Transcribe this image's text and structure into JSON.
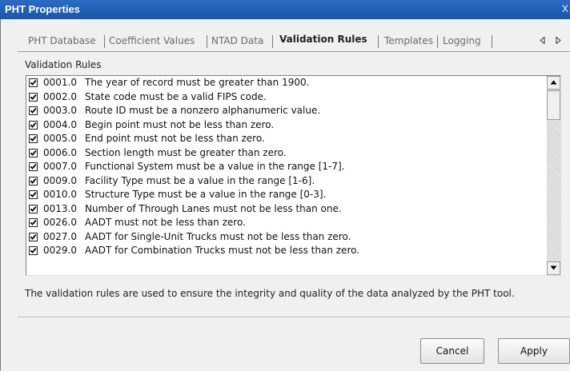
{
  "window": {
    "title": "PHT Properties",
    "close_glyph": "X"
  },
  "tabs": [
    {
      "label": "PHT Database",
      "active": false
    },
    {
      "label": "Coefficient Values",
      "active": false
    },
    {
      "label": "NTAD Data",
      "active": false
    },
    {
      "label": "Validation Rules",
      "active": true
    },
    {
      "label": "Templates",
      "active": false
    },
    {
      "label": "Logging",
      "active": false
    }
  ],
  "tab_scroll": {
    "left_icon": "triangle-left-icon",
    "right_icon": "triangle-right-icon"
  },
  "group_label": "Validation Rules",
  "rules": [
    {
      "code": "0001.0",
      "text": "The year of record must be greater than 1900.",
      "checked": true
    },
    {
      "code": "0002.0",
      "text": "State code must be a valid FIPS code.",
      "checked": true
    },
    {
      "code": "0003.0",
      "text": "Route ID must be a nonzero alphanumeric value.",
      "checked": true
    },
    {
      "code": "0004.0",
      "text": "Begin point must not be less than zero.",
      "checked": true
    },
    {
      "code": "0005.0",
      "text": "End point must not be less than zero.",
      "checked": true
    },
    {
      "code": "0006.0",
      "text": "Section length must be greater than zero.",
      "checked": true
    },
    {
      "code": "0007.0",
      "text": "Functional System must be a value in the range [1-7].",
      "checked": true
    },
    {
      "code": "0009.0",
      "text": "Facility Type must be a value in the range [1-6].",
      "checked": true
    },
    {
      "code": "0010.0",
      "text": "Structure Type must be a value in the range [0-3].",
      "checked": true
    },
    {
      "code": "0013.0",
      "text": "Number of Through Lanes must not be less than one.",
      "checked": true
    },
    {
      "code": "0026.0",
      "text": "AADT must not be less than zero.",
      "checked": true
    },
    {
      "code": "0027.0",
      "text": "AADT for Single-Unit Trucks must not be less than zero.",
      "checked": true
    },
    {
      "code": "0029.0",
      "text": "AADT for Combination Trucks must not be less than zero.",
      "checked": true
    }
  ],
  "footnote": "The validation rules are used to ensure the integrity and quality of the data analyzed by the PHT tool.",
  "buttons": {
    "cancel": "Cancel",
    "apply": "Apply"
  },
  "colors": {
    "titlebar": "#1a55a8",
    "window_bg": "#f0f0f0",
    "list_bg": "#ffffff"
  }
}
